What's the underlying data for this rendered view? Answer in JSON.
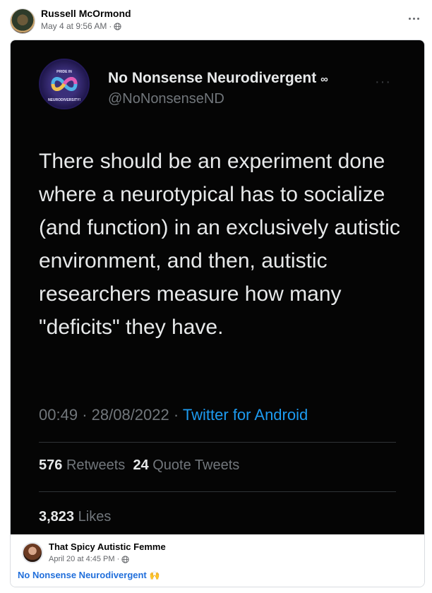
{
  "post": {
    "author": "Russell McOrmond",
    "timestamp": "May 4 at 9:56 AM",
    "separator": "·",
    "privacy_icon": "globe-icon",
    "more_icon": "more-options-icon"
  },
  "tweet": {
    "avatar_text_top": "PRIDE IN",
    "avatar_text_bottom": "NEURODIVERSITY!",
    "display_name": "No Nonsense Neurodivergent",
    "name_suffix": "∞",
    "more_icon": "···",
    "handle": "@NoNonsenseND",
    "text": "There should be an experiment done where a neurotypical has to socialize (and function) in an exclusively autistic environment, and then, autistic researchers measure how many \"deficits\" they have.",
    "time": "00:49",
    "date": "28/08/2022",
    "dot": "·",
    "client": "Twitter for Android",
    "retweets_count": "576",
    "retweets_label": "Retweets",
    "quote_count": "24",
    "quote_label": "Quote Tweets",
    "likes_count": "3,823",
    "likes_label": "Likes"
  },
  "original_post": {
    "author": "That Spicy Autistic Femme",
    "timestamp": "April 20 at 4:45 PM",
    "separator": "·",
    "link_text": "No Nonsense Neurodivergent",
    "emoji": "🙌"
  },
  "colors": {
    "tweet_background": "#050505",
    "link_blue": "#216fdb",
    "twitter_blue": "#1d9bf0"
  }
}
